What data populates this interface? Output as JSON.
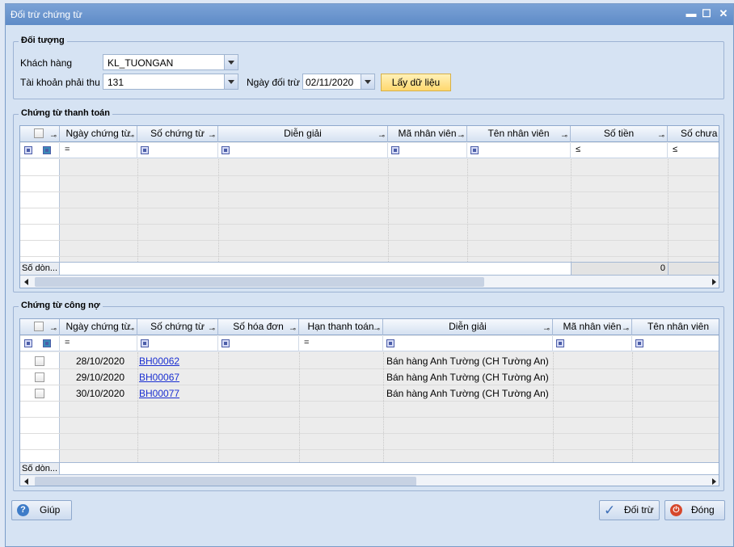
{
  "window": {
    "title": "Đối trừ chứng từ",
    "minimize": "▬",
    "maximize": "☐",
    "close": "✕"
  },
  "doi_tuong": {
    "group_label": "Đối tượng",
    "khach_hang_label": "Khách hàng",
    "khach_hang_value": "KL_TUONGAN",
    "tai_khoan_label": "Tài khoản phải thu",
    "tai_khoan_value": "131",
    "ngay_label": "Ngày đối trừ",
    "ngay_value": "02/11/2020",
    "lay_du_lieu_label": "Lấy dữ liệu"
  },
  "thanh_toan": {
    "group_label": "Chứng từ thanh toán",
    "columns": [
      "Ngày chứng từ",
      "Số chứng từ",
      "Diễn giải",
      "Mã nhân viên",
      "Tên nhân viên",
      "Số tiền",
      "Số chưa đ"
    ],
    "filter_ops": [
      "=",
      "≤",
      "≤"
    ],
    "footer_label": "Số dòn...",
    "footer_total": "0"
  },
  "cong_no": {
    "group_label": "Chứng từ công nợ",
    "columns": [
      "Ngày chứng từ",
      "Số chứng từ",
      "Số hóa đơn",
      "Hạn thanh toán",
      "Diễn giải",
      "Mã nhân viên",
      "Tên nhân viên"
    ],
    "filter_ops": [
      "=",
      "="
    ],
    "rows": [
      {
        "ngay": "28/10/2020",
        "so_ct": "BH00062",
        "dien_giai": "Bán hàng Anh Tường (CH Tường An)"
      },
      {
        "ngay": "29/10/2020",
        "so_ct": "BH00067",
        "dien_giai": "Bán hàng Anh Tường (CH Tường An)"
      },
      {
        "ngay": "30/10/2020",
        "so_ct": "BH00077",
        "dien_giai": "Bán hàng Anh Tường (CH Tường An)"
      }
    ],
    "footer_label": "Số dòn..."
  },
  "buttons": {
    "giup": "Giúp",
    "doi_tru": "Đối trừ",
    "dong": "Đóng"
  },
  "colors": {
    "title_bar": "#5e8bc7",
    "link": "#1a2fd1",
    "yellow_button": "#ffd86e"
  }
}
